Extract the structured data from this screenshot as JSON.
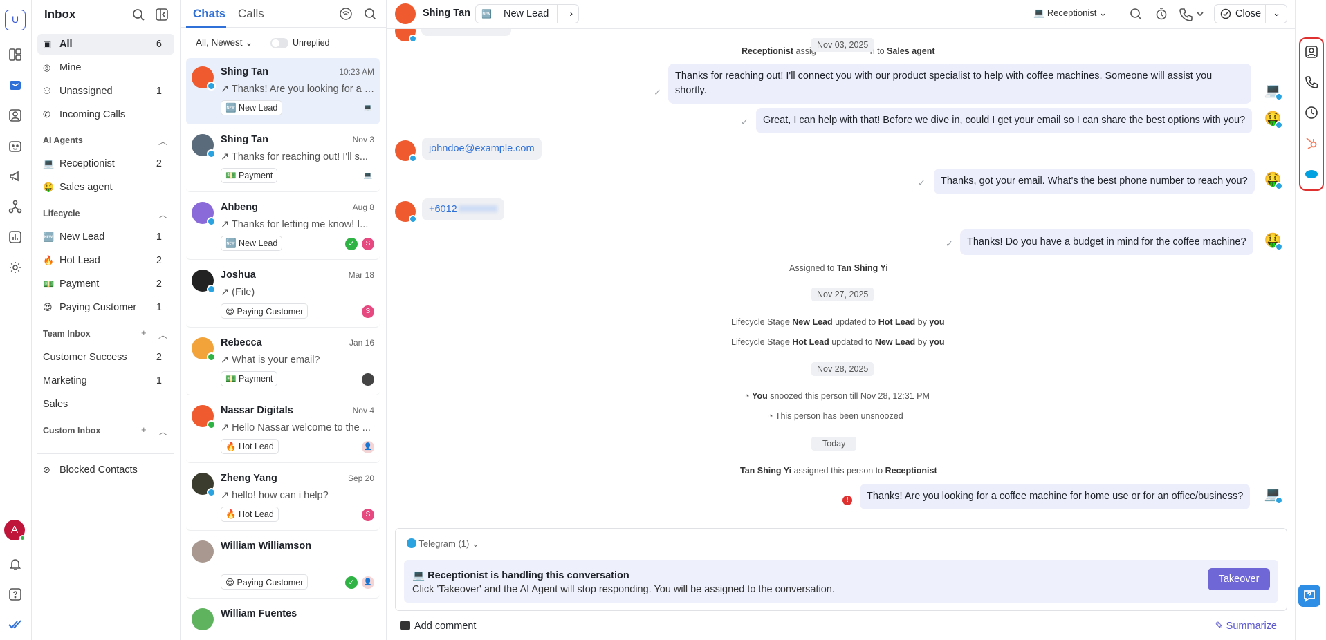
{
  "workspace": {
    "initial": "U"
  },
  "user": {
    "initial": "A",
    "color": "#c0153a"
  },
  "sidebar": {
    "title": "Inbox",
    "items": [
      {
        "label": "All",
        "count": "6"
      },
      {
        "label": "Mine",
        "count": ""
      },
      {
        "label": "Unassigned",
        "count": "1"
      },
      {
        "label": "Incoming Calls",
        "count": ""
      }
    ],
    "ai_section": "AI Agents",
    "ai_agents": [
      {
        "emoji": "💻",
        "label": "Receptionist",
        "count": "2"
      },
      {
        "emoji": "🤑",
        "label": "Sales agent",
        "count": ""
      }
    ],
    "lifecycle_section": "Lifecycle",
    "lifecycle": [
      {
        "emoji": "🆕",
        "label": "New Lead",
        "count": "1"
      },
      {
        "emoji": "🔥",
        "label": "Hot Lead",
        "count": "2"
      },
      {
        "emoji": "💵",
        "label": "Payment",
        "count": "2"
      },
      {
        "emoji": "😍",
        "label": "Paying Customer",
        "count": "1"
      }
    ],
    "team_section": "Team Inbox",
    "team": [
      {
        "label": "Customer Success",
        "count": "2"
      },
      {
        "label": "Marketing",
        "count": "1"
      },
      {
        "label": "Sales",
        "count": ""
      }
    ],
    "custom_section": "Custom Inbox",
    "blocked": "Blocked Contacts"
  },
  "list": {
    "tabs": [
      "Chats",
      "Calls"
    ],
    "filter": "All, Newest",
    "unreplied": "Unreplied",
    "items": [
      {
        "name": "Shing Tan",
        "date": "10:23 AM",
        "preview": "↗ Thanks! Are you looking for a coffee machine",
        "tag": "🆕 New Lead",
        "avatar": "#f05a2f",
        "right": "💻"
      },
      {
        "name": "Shing Tan",
        "date": "Nov 3",
        "preview": "↗ Thanks for reaching out! I'll s...",
        "tag": "💵 Payment",
        "avatar": "#5a6b7b",
        "right": "💻"
      },
      {
        "name": "Ahbeng",
        "date": "Aug 8",
        "preview": "↗ Thanks for letting me know! I...",
        "tag": "🆕 New Lead",
        "avatar": "#8a6ad8",
        "right": "S"
      },
      {
        "name": "Joshua",
        "date": "Mar 18",
        "preview": "↗ (File)",
        "tag": "😍 Paying Customer",
        "avatar": "#222",
        "right": "S"
      },
      {
        "name": "Rebecca",
        "date": "Jan 16",
        "preview": "↗ What is your email?",
        "tag": "💵 Payment",
        "avatar": "#f2a33a",
        "right": ""
      },
      {
        "name": "Nassar Digitals",
        "date": "Nov 4",
        "preview": "↗ Hello Nassar welcome to the ...",
        "tag": "🔥 Hot Lead",
        "avatar": "#f05a2f",
        "right": ""
      },
      {
        "name": "Zheng Yang",
        "date": "Sep 20",
        "preview": "↗ hello! how can i help?",
        "tag": "🔥 Hot Lead",
        "avatar": "#3b3b2e",
        "right": "S"
      },
      {
        "name": "William Williamson",
        "date": "",
        "preview": "",
        "tag": "😍 Paying Customer",
        "avatar": "#a89890",
        "right": ""
      },
      {
        "name": "William Fuentes",
        "date": "",
        "preview": "",
        "tag": "",
        "avatar": "#5fb35f",
        "right": ""
      }
    ]
  },
  "chat": {
    "contact": "Shing Tan",
    "stage": "New Lead",
    "stage_emoji": "🆕",
    "agent": "Receptionist",
    "close": "Close",
    "sys1_a": "Receptionist",
    "sys1_b": "assig",
    "sys1_c": "n to",
    "sys1_d": "Sales agent",
    "date1": "Nov 03, 2025",
    "m1": "Thanks for reaching out! I'll connect you with our product specialist to help with coffee machines. Someone will assist you shortly.",
    "m2": "Great, I can help with that! Before we dive in, could I get your email so I can share the best options with you?",
    "m3": "johndoe@example.com",
    "m4": "Thanks, got your email. What's the best phone number to reach you?",
    "m5": "+6012",
    "m6": "Thanks! Do you have a budget in mind for the coffee machine?",
    "assigned_prefix": "Assigned to",
    "assigned_name": "Tan Shing Yi",
    "date2": "Nov 27, 2025",
    "lc1_a": "Lifecycle Stage",
    "lc1_b": "New Lead",
    "lc1_c": "updated to",
    "lc1_d": "Hot Lead",
    "lc1_e": "by",
    "lc1_f": "you",
    "lc2_a": "Lifecycle Stage",
    "lc2_b": "Hot Lead",
    "lc2_c": "updated to",
    "lc2_d": "New Lead",
    "lc2_e": "by",
    "lc2_f": "you",
    "date3": "Nov 28, 2025",
    "snooze_a": "You",
    "snooze_b": "snoozed this person till Nov 28, 12:31 PM",
    "unsnooze": "This person has been unsnoozed",
    "date4": "Today",
    "assign2_a": "Tan Shing Yi",
    "assign2_b": "assigned this person to",
    "assign2_c": "Receptionist",
    "m7": "Thanks! Are you looking for a coffee machine for home use or for an office/business?"
  },
  "composer": {
    "channel": "Telegram (1)",
    "notice_title": "Receptionist is handling this conversation",
    "notice_text": "Click 'Takeover' and the AI Agent will stop responding. You will be assigned to the conversation.",
    "takeover": "Takeover",
    "comment": "Add comment",
    "summarize": "Summarize"
  },
  "colors": {
    "accent": "#2e6fd8",
    "highlight": "#e03131",
    "button": "#7067d6"
  }
}
